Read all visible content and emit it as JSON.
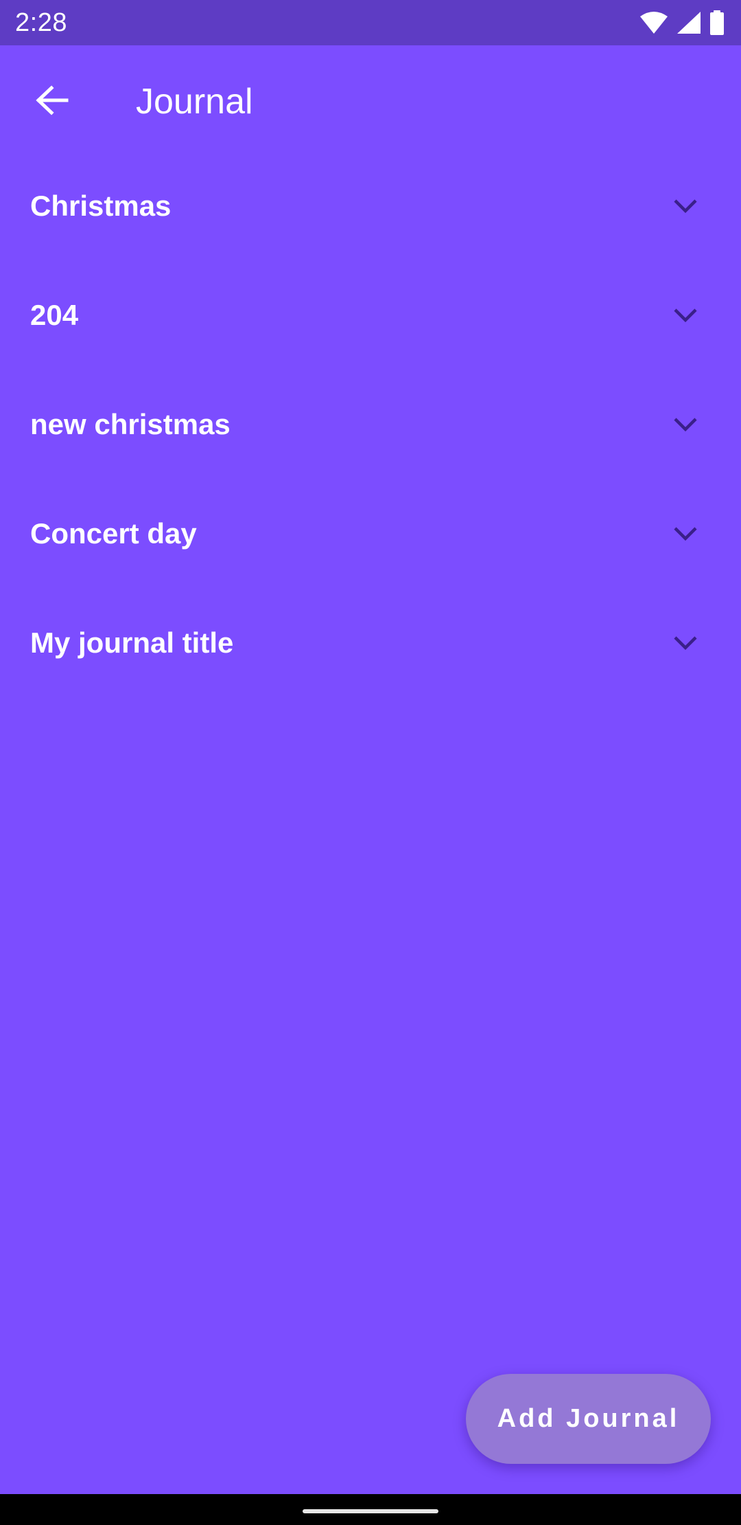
{
  "status_bar": {
    "time": "2:28",
    "icons": [
      "wifi-icon",
      "signal-icon",
      "battery-icon"
    ]
  },
  "app_bar": {
    "back_icon": "arrow-back-icon",
    "title": "Journal"
  },
  "journals": [
    {
      "title": "Christmas",
      "icon": "chevron-down-icon"
    },
    {
      "title": "204",
      "icon": "chevron-down-icon"
    },
    {
      "title": "new christmas",
      "icon": "chevron-down-icon"
    },
    {
      "title": "Concert day",
      "icon": "chevron-down-icon"
    },
    {
      "title": "My journal title",
      "icon": "chevron-down-icon"
    }
  ],
  "fab": {
    "label": "Add Journal"
  },
  "colors": {
    "background": "#7c4dff",
    "status_bar": "#5e3cc4",
    "fab": "#9478d6",
    "chevron": "#3a1f8a",
    "text": "#ffffff"
  }
}
